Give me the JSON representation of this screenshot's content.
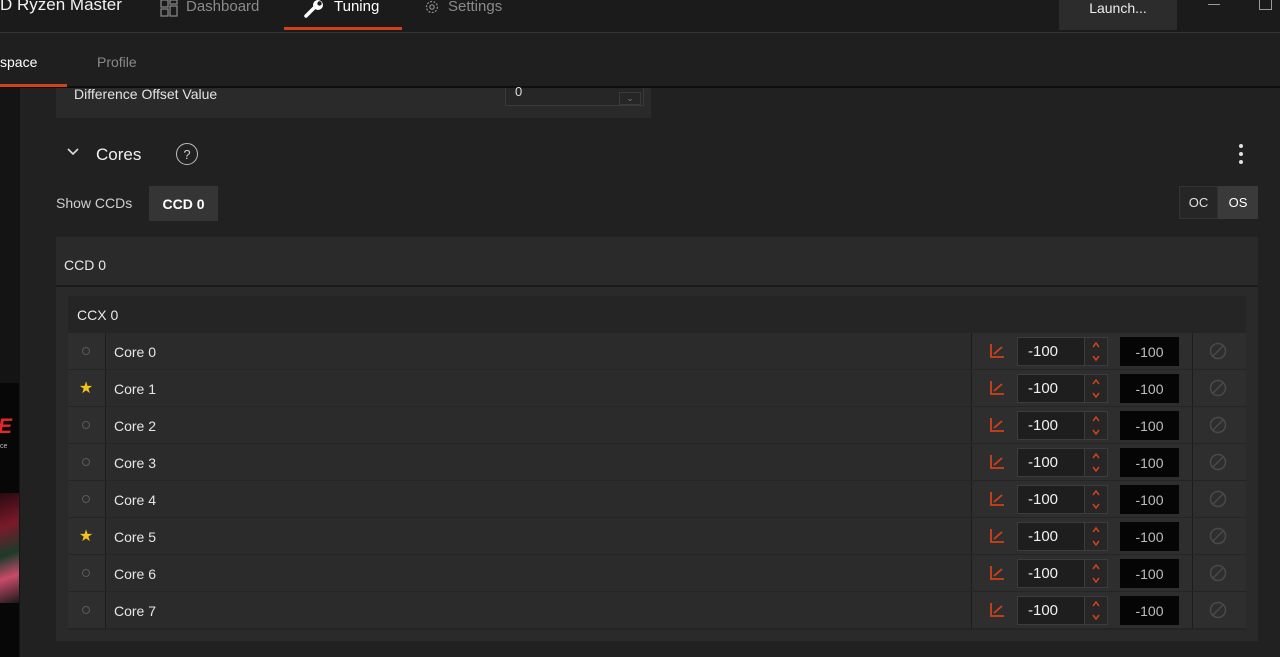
{
  "app": {
    "title": "D Ryzen Master",
    "nav_tabs": [
      {
        "label": "Dashboard",
        "icon": "dashboard-icon"
      },
      {
        "label": "Tuning",
        "icon": "wrench-icon"
      },
      {
        "label": "Settings",
        "icon": "gear-icon"
      }
    ],
    "active_tab": "Tuning",
    "launch_label": "Launch..."
  },
  "subtabs": {
    "workspace": "space",
    "profile": "Profile"
  },
  "promo": {
    "letter": "E",
    "text": "ce"
  },
  "offset": {
    "label": "Difference Offset Value",
    "value": "0"
  },
  "cores_section": {
    "title": "Cores",
    "help": "?",
    "show_ccds_label": "Show CCDs",
    "ccd_button": "CCD 0",
    "mode_oc": "OC",
    "mode_os": "OS",
    "active_mode": "OS",
    "ccd_title": "CCD 0",
    "ccx_title": "CCX 0"
  },
  "accent_color": "#d0421b",
  "star_color": "#f6c21b",
  "cores": [
    {
      "name": "Core 0",
      "starred": false,
      "value": "-100",
      "current": "-100"
    },
    {
      "name": "Core 1",
      "starred": true,
      "value": "-100",
      "current": "-100"
    },
    {
      "name": "Core 2",
      "starred": false,
      "value": "-100",
      "current": "-100"
    },
    {
      "name": "Core 3",
      "starred": false,
      "value": "-100",
      "current": "-100"
    },
    {
      "name": "Core 4",
      "starred": false,
      "value": "-100",
      "current": "-100"
    },
    {
      "name": "Core 5",
      "starred": true,
      "value": "-100",
      "current": "-100"
    },
    {
      "name": "Core 6",
      "starred": false,
      "value": "-100",
      "current": "-100"
    },
    {
      "name": "Core 7",
      "starred": false,
      "value": "-100",
      "current": "-100"
    }
  ]
}
